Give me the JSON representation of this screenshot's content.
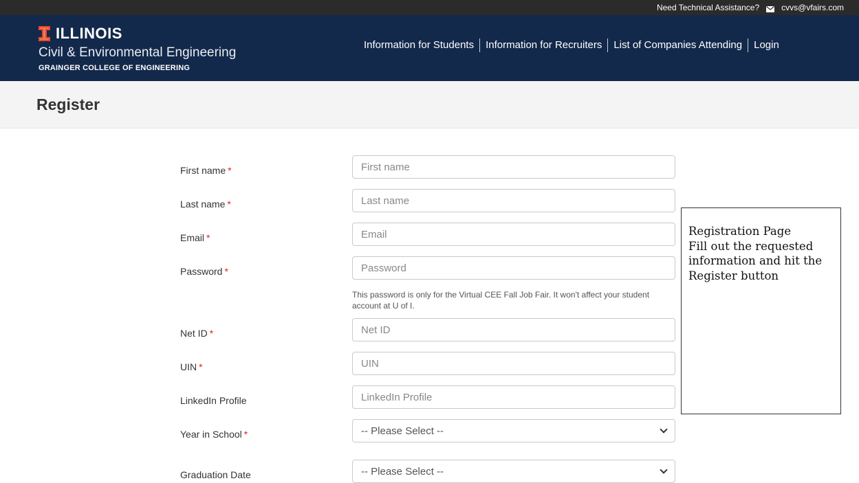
{
  "topbar": {
    "assist_text": "Need Technical Assistance?",
    "email": "cvvs@vfairs.com"
  },
  "logo": {
    "wordmark": "ILLINOIS",
    "department": "Civil & Environmental Engineering",
    "college": "GRAINGER COLLEGE OF ENGINEERING",
    "brand_color": "#e84a27"
  },
  "nav": {
    "items": [
      {
        "label": "Information for Students"
      },
      {
        "label": "Information for Recruiters"
      },
      {
        "label": "List of Companies Attending"
      },
      {
        "label": "Login"
      }
    ]
  },
  "page": {
    "title": "Register"
  },
  "form": {
    "fields": [
      {
        "label": "First name",
        "required": "*",
        "placeholder": "First name"
      },
      {
        "label": "Last name",
        "required": "*",
        "placeholder": "Last name"
      },
      {
        "label": "Email",
        "required": "*",
        "placeholder": "Email"
      },
      {
        "label": "Password",
        "required": "*",
        "placeholder": "Password"
      },
      {
        "label": "Net ID",
        "required": "*",
        "placeholder": "Net ID"
      },
      {
        "label": "UIN",
        "required": "*",
        "placeholder": "UIN"
      },
      {
        "label": "LinkedIn Profile",
        "required": "",
        "placeholder": "LinkedIn Profile"
      },
      {
        "label": "Year in School",
        "required": "*",
        "selected": "-- Please Select --"
      },
      {
        "label": "Graduation Date",
        "required": "",
        "selected": "-- Please Select --"
      }
    ],
    "password_hint": "This password is only for the Virtual CEE Fall Job Fair. It won't affect your student account at U of I."
  },
  "note": {
    "line1": "Registration Page",
    "line2": "Fill out the requested information and hit the Register button"
  },
  "colors": {
    "header_bg": "#13294b",
    "topbar_bg": "#2b2b2b",
    "required": "#e02020"
  }
}
